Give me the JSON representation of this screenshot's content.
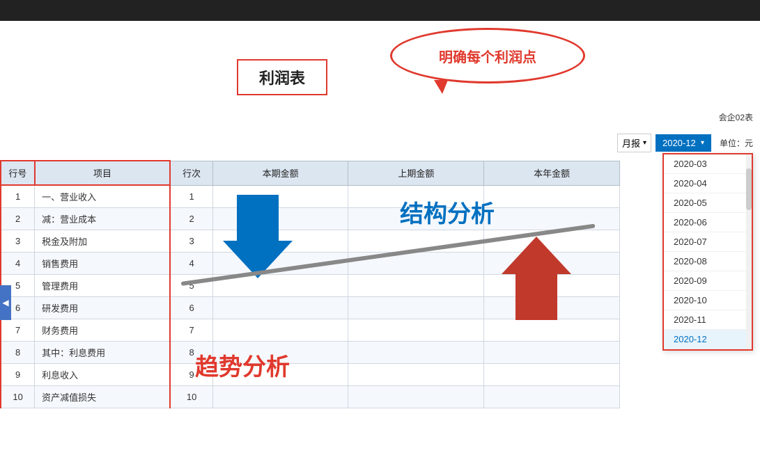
{
  "topBar": {
    "color": "#222"
  },
  "callout": {
    "text": "明确每个利润点"
  },
  "title": {
    "text": "利润表"
  },
  "rightInfo": {
    "label": "会企02表"
  },
  "controls": {
    "reportType": "月报",
    "chevron": "▾",
    "period": "2020-12",
    "unit": "单位：元"
  },
  "dropdown": {
    "items": [
      {
        "value": "2020-03",
        "selected": false
      },
      {
        "value": "2020-04",
        "selected": false
      },
      {
        "value": "2020-05",
        "selected": false
      },
      {
        "value": "2020-06",
        "selected": false
      },
      {
        "value": "2020-07",
        "selected": false
      },
      {
        "value": "2020-08",
        "selected": false
      },
      {
        "value": "2020-09",
        "selected": false
      },
      {
        "value": "2020-10",
        "selected": false
      },
      {
        "value": "2020-11",
        "selected": false
      },
      {
        "value": "2020-12",
        "selected": true
      }
    ]
  },
  "table": {
    "headers": [
      "行号",
      "项目",
      "行次",
      "本期金额",
      "上期金额",
      "本年金额"
    ],
    "rows": [
      {
        "rowNum": "1",
        "item": "一、营业收入",
        "seq": "1",
        "current": "",
        "prev": "",
        "ytd": ""
      },
      {
        "rowNum": "2",
        "item": "减：营业成本",
        "seq": "2",
        "current": "",
        "prev": "",
        "ytd": ""
      },
      {
        "rowNum": "3",
        "item": "税金及附加",
        "seq": "3",
        "current": "",
        "prev": "",
        "ytd": ""
      },
      {
        "rowNum": "4",
        "item": "销售费用",
        "seq": "4",
        "current": "",
        "prev": "",
        "ytd": ""
      },
      {
        "rowNum": "5",
        "item": "管理费用",
        "seq": "5",
        "current": "",
        "prev": "",
        "ytd": ""
      },
      {
        "rowNum": "6",
        "item": "研发费用",
        "seq": "6",
        "current": "",
        "prev": "",
        "ytd": ""
      },
      {
        "rowNum": "7",
        "item": "财务费用",
        "seq": "7",
        "current": "",
        "prev": "",
        "ytd": ""
      },
      {
        "rowNum": "8",
        "item": "其中：利息费用",
        "seq": "8",
        "current": "",
        "prev": "",
        "ytd": ""
      },
      {
        "rowNum": "9",
        "item": "利息收入",
        "seq": "9",
        "current": "",
        "prev": "",
        "ytd": ""
      },
      {
        "rowNum": "10",
        "item": "资产减值损失",
        "seq": "10",
        "current": "",
        "prev": "",
        "ytd": ""
      }
    ]
  },
  "overlays": {
    "jiegouText": "结构分析",
    "qushiText": "趋势分析"
  },
  "sidebarToggle": "◀"
}
